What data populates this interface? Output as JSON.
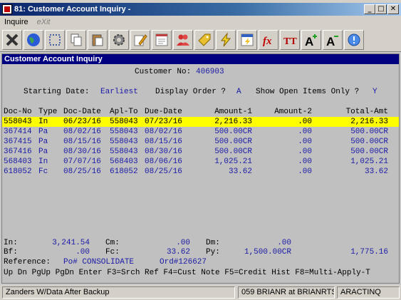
{
  "window": {
    "title": "81: Customer Account Inquiry -"
  },
  "menu": {
    "inquire": "Inquire",
    "exit": "eXit"
  },
  "toolbar": {
    "icons": [
      "close-icon",
      "globe-icon",
      "select-icon",
      "copy-icon",
      "paste-icon",
      "settings-icon",
      "edit-icon",
      "form-icon",
      "users-icon",
      "tag-icon",
      "lightning-icon",
      "calculator-icon",
      "function-icon",
      "font-icon",
      "font-increase-icon",
      "font-decrease-icon",
      "help-icon"
    ],
    "fx_label": "fx",
    "tt_label": "TT",
    "a_plus": "A",
    "a_minus": "A"
  },
  "screen": {
    "header": "Customer Account Inquiry",
    "customer_label": "Customer No:",
    "customer_no": "406903",
    "starting_label": "Starting Date:",
    "starting_value": "Earliest",
    "display_label": "Display Order ?",
    "display_value": "A",
    "open_label": "Show Open Items Only ?",
    "open_value": "Y",
    "columns": [
      "Doc-No",
      "Type",
      "Doc-Date",
      "Apl-To",
      "Due-Date",
      "Amount-1",
      "Amount-2",
      "Total-Amt"
    ],
    "rows": [
      {
        "doc": "558043",
        "type": "In",
        "date": "06/23/16",
        "apl": "558043",
        "due": "07/23/16",
        "amt1": "2,216.33",
        "amt2": ".00",
        "total": "2,216.33",
        "selected": true
      },
      {
        "doc": "367414",
        "type": "Pa",
        "date": "08/02/16",
        "apl": "558043",
        "due": "08/02/16",
        "amt1": "500.00CR",
        "amt2": ".00",
        "total": "500.00CR",
        "selected": false
      },
      {
        "doc": "367415",
        "type": "Pa",
        "date": "08/15/16",
        "apl": "558043",
        "due": "08/15/16",
        "amt1": "500.00CR",
        "amt2": ".00",
        "total": "500.00CR",
        "selected": false
      },
      {
        "doc": "367416",
        "type": "Pa",
        "date": "08/30/16",
        "apl": "558043",
        "due": "08/30/16",
        "amt1": "500.00CR",
        "amt2": ".00",
        "total": "500.00CR",
        "selected": false
      },
      {
        "doc": "568403",
        "type": "In",
        "date": "07/07/16",
        "apl": "568403",
        "due": "08/06/16",
        "amt1": "1,025.21",
        "amt2": ".00",
        "total": "1,025.21",
        "selected": false
      },
      {
        "doc": "618052",
        "type": "Fc",
        "date": "08/25/16",
        "apl": "618052",
        "due": "08/25/16",
        "amt1": "33.62",
        "amt2": ".00",
        "total": "33.62",
        "selected": false
      }
    ],
    "totals": {
      "in_label": "In:",
      "in_value": "3,241.54",
      "cm_label": "Cm:",
      "cm_value": ".00",
      "dm_label": "Dm:",
      "dm_value": ".00",
      "bf_label": "Bf:",
      "bf_value": ".00",
      "fc_label": "Fc:",
      "fc_value": "33.62",
      "py_label": "Py:",
      "py_value": "1,500.00CR",
      "balance": "1,775.16"
    },
    "reference_label": "Reference:",
    "reference_value": "Po# CONSOLIDATE",
    "ord_value": "Ord#126627",
    "function_keys": "Up Dn PgUp PgDn Enter F3=Srch Ref F4=Cust Note F5=Credit Hist F8=Multi-Apply-T"
  },
  "status": {
    "database": "Zanders W/Data After Backup",
    "user": "059 BRIANR at BRIANRTS",
    "program": "ARACTINQ"
  }
}
